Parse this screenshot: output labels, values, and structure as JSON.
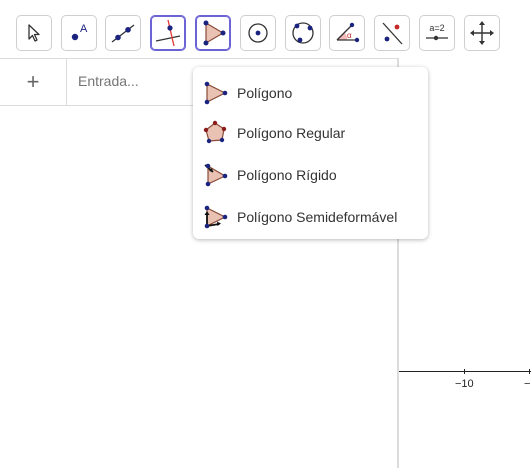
{
  "toolbar": {
    "tools": [
      {
        "name": "move-tool",
        "label": "Mover"
      },
      {
        "name": "point-tool",
        "label": "A"
      },
      {
        "name": "line-tool",
        "label": "Reta"
      },
      {
        "name": "perpendicular-tool",
        "label": "Perpendicular"
      },
      {
        "name": "polygon-tool",
        "label": "Polígono"
      },
      {
        "name": "circle-tool",
        "label": "Círculo"
      },
      {
        "name": "conic-tool",
        "label": "Cônica"
      },
      {
        "name": "angle-tool",
        "label": "Ângulo"
      },
      {
        "name": "reflect-tool",
        "label": "Reflexão"
      },
      {
        "name": "slider-tool",
        "label": "a=2"
      },
      {
        "name": "move-view-tool",
        "label": "Mover Janela"
      }
    ]
  },
  "algebra": {
    "add_symbol": "+",
    "input_placeholder": "Entrada..."
  },
  "menu": {
    "items": [
      {
        "label": "Polígono"
      },
      {
        "label": "Polígono Regular"
      },
      {
        "label": "Polígono Rígido"
      },
      {
        "label": "Polígono Semideformável"
      }
    ]
  },
  "graphics": {
    "tick_labels": [
      "−10",
      "−"
    ]
  },
  "colors": {
    "accent": "#6c63d5",
    "point": "#1a237e",
    "polygon_fill": "#e9c2b3",
    "polygon_stroke": "#8a4b38"
  }
}
